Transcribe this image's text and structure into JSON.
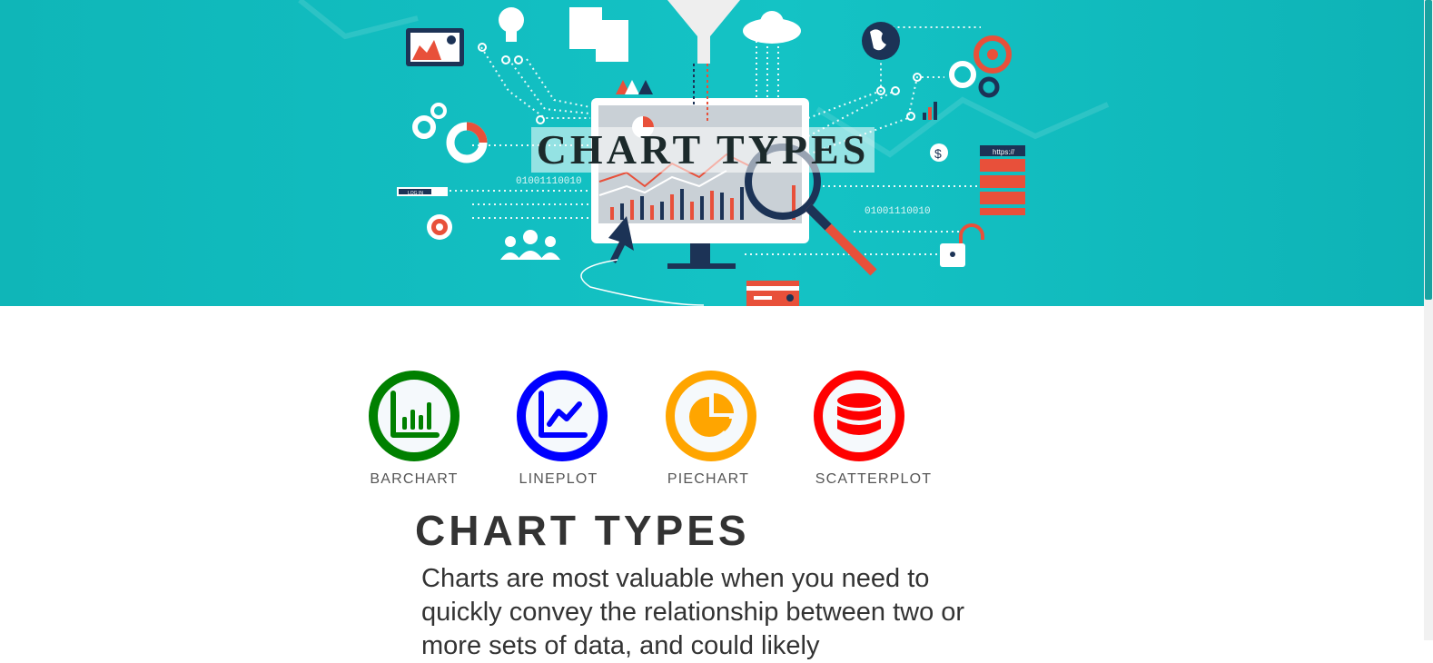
{
  "hero": {
    "title": "CHART TYPES",
    "binary_left": "01001110010",
    "binary_right": "01001110010",
    "login_label": "LOG IN",
    "https_label": "https://"
  },
  "chart_types": [
    {
      "label": "BARCHART",
      "icon": "bar-chart-icon",
      "color": "#008000"
    },
    {
      "label": "LINEPLOT",
      "icon": "line-chart-icon",
      "color": "#0000ff"
    },
    {
      "label": "PIECHART",
      "icon": "pie-chart-icon",
      "color": "#ffa500"
    },
    {
      "label": "SCATTERPLOT",
      "icon": "database-icon",
      "color": "#ff0000"
    }
  ],
  "section": {
    "heading": "CHART TYPES",
    "description": "Charts are most valuable when you need to quickly convey the relationship between two or more sets of data, and could likely"
  },
  "colors": {
    "hero_bg": "#12bec1",
    "accent_red": "#e8503a",
    "navy": "#1c3356"
  }
}
